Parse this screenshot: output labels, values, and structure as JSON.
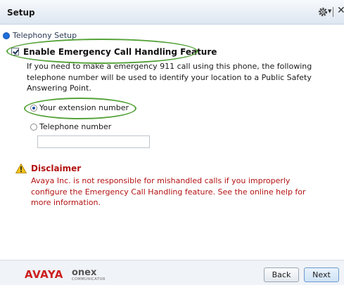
{
  "window": {
    "title": "Setup"
  },
  "titlebar": {
    "gear_icon": "gear-icon",
    "caret_icon": "chevron-down-icon",
    "close_icon": "close-icon",
    "close_glyph": "✕"
  },
  "section": {
    "label": "Telephony Setup",
    "icon": "radio-bullet-icon"
  },
  "emergency": {
    "checkbox_label": "Enable Emergency Call Handling Feature",
    "checked": true,
    "description_lines": [
      "If you need to make a emergency 911 call using this phone, the following",
      "telephone number will be used to identify your location to a Public Safety",
      "Answering Point."
    ],
    "options": [
      {
        "label": "Your extension number",
        "selected": true
      },
      {
        "label": "Telephone number",
        "selected": false
      }
    ],
    "telephone_value": ""
  },
  "disclaimer": {
    "icon": "warning-icon",
    "title": "Disclaimer",
    "lines": [
      "Avaya Inc. is not responsible for mishandled calls if you improperly",
      "configure the Emergency Call Handling feature. See the online help for",
      "more information."
    ]
  },
  "footer": {
    "logo_brand": "AVAYA",
    "logo_product": "onex",
    "logo_sub": "COMMUNICATOR",
    "back_label": "Back",
    "next_label": "Next"
  },
  "colors": {
    "disclaimer": "#b31212",
    "highlight": "#55a33a",
    "accent": "#1e6fd9"
  }
}
